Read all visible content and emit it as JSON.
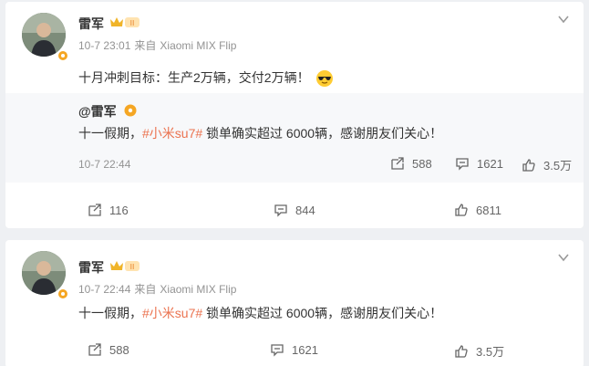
{
  "posts": [
    {
      "author": "雷军",
      "time": "10-7 23:01",
      "source_prefix": "来自",
      "source": "Xiaomi MIX Flip",
      "text": "十月冲刺目标：生产2万辆，交付2万辆！",
      "emoji_icon": "sunglasses-emoji-icon",
      "quoted": {
        "author": "@雷军",
        "text_before": "十一假期，",
        "topic": "#小米su7#",
        "text_after": " 锁单确实超过 6000辆，感谢朋友们关心！",
        "time": "10-7 22:44",
        "reposts": "588",
        "comments": "1621",
        "likes": "3.5万"
      },
      "reposts": "116",
      "comments": "844",
      "likes": "6811"
    },
    {
      "author": "雷军",
      "time": "10-7 22:44",
      "source_prefix": "来自",
      "source": "Xiaomi MIX Flip",
      "text_before": "十一假期，",
      "topic": "#小米su7#",
      "text_after": " 锁单确实超过 6000辆，感谢朋友们关心！",
      "reposts": "588",
      "comments": "1621",
      "likes": "3.5万"
    }
  ],
  "colors": {
    "topic": "#eb7350",
    "meta": "#939393",
    "badge": "#f5a623"
  }
}
